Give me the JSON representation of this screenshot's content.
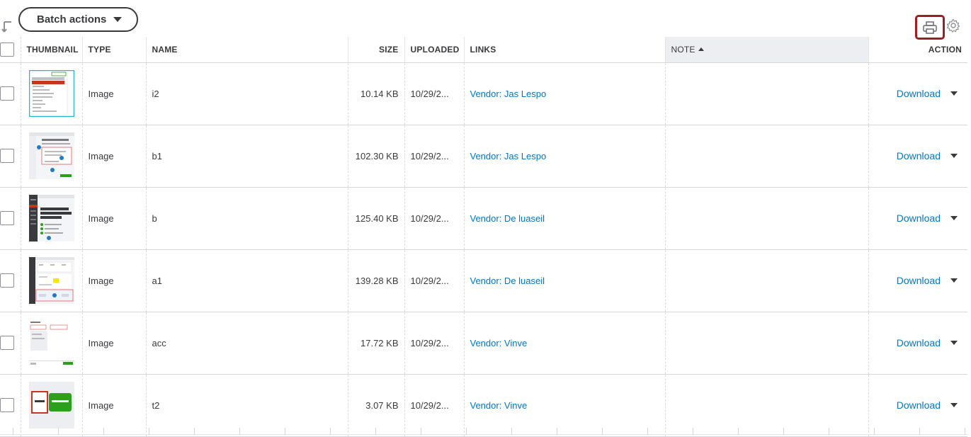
{
  "toolbar": {
    "batch_actions_label": "Batch actions",
    "sort_icon": "sort-down-arrow-icon",
    "print_icon": "printer-icon",
    "settings_icon": "gear-icon"
  },
  "table": {
    "columns": {
      "thumbnail": "THUMBNAIL",
      "type": "TYPE",
      "name": "NAME",
      "size": "SIZE",
      "uploaded": "UPLOADED",
      "links": "LINKS",
      "note": "NOTE",
      "action": "ACTION"
    },
    "sorted_column": "note",
    "rows": [
      {
        "type": "Image",
        "name": "i2",
        "size": "10.14 KB",
        "uploaded": "10/29/2...",
        "link": "Vendor: Jas Lespo",
        "note": "",
        "action": "Download"
      },
      {
        "type": "Image",
        "name": "b1",
        "size": "102.30 KB",
        "uploaded": "10/29/2...",
        "link": "Vendor: Jas Lespo",
        "note": "",
        "action": "Download"
      },
      {
        "type": "Image",
        "name": "b",
        "size": "125.40 KB",
        "uploaded": "10/29/2...",
        "link": "Vendor: De luaseil",
        "note": "",
        "action": "Download"
      },
      {
        "type": "Image",
        "name": "a1",
        "size": "139.28 KB",
        "uploaded": "10/29/2...",
        "link": "Vendor: De luaseil",
        "note": "",
        "action": "Download"
      },
      {
        "type": "Image",
        "name": "acc",
        "size": "17.72 KB",
        "uploaded": "10/29/2...",
        "link": "Vendor: Vinve",
        "note": "",
        "action": "Download"
      },
      {
        "type": "Image",
        "name": "t2",
        "size": "3.07 KB",
        "uploaded": "10/29/2...",
        "link": "Vendor: Vinve",
        "note": "",
        "action": "Download"
      }
    ]
  },
  "colors": {
    "link": "#0077c5",
    "print_highlight": "#a01d21",
    "sorted_header_bg": "#eceef1",
    "text": "#393a3d"
  }
}
